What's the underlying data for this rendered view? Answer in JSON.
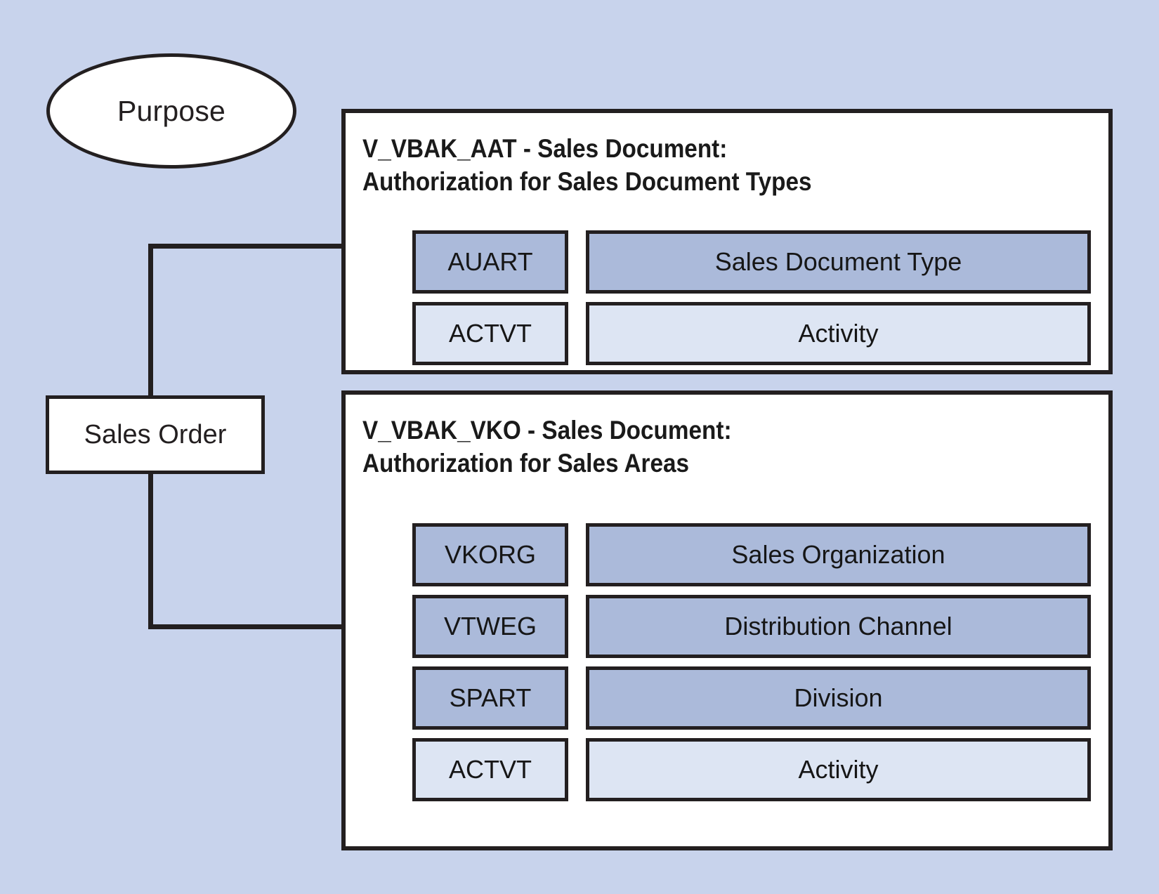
{
  "diagram": {
    "background_color": "#c8d3ec",
    "line_color": "#231f20",
    "fill_dark": "#abbada",
    "fill_light": "#dde5f3"
  },
  "purpose_node": {
    "label": "Purpose"
  },
  "object_node": {
    "label": "Sales Order"
  },
  "panels": [
    {
      "id": "V_VBAK_AAT",
      "title": "V_VBAK_AAT - Sales Document:\nAuthorization for Sales Document Types",
      "fields": [
        {
          "code": "AUART",
          "description": "Sales Document Type",
          "shade": "dark"
        },
        {
          "code": "ACTVT",
          "description": "Activity",
          "shade": "light"
        }
      ]
    },
    {
      "id": "V_VBAK_VKO",
      "title": "V_VBAK_VKO - Sales Document:\nAuthorization for Sales Areas",
      "fields": [
        {
          "code": "VKORG",
          "description": "Sales Organization",
          "shade": "dark"
        },
        {
          "code": "VTWEG",
          "description": "Distribution Channel",
          "shade": "dark"
        },
        {
          "code": "SPART",
          "description": "Division",
          "shade": "dark"
        },
        {
          "code": "ACTVT",
          "description": "Activity",
          "shade": "light"
        }
      ]
    }
  ]
}
